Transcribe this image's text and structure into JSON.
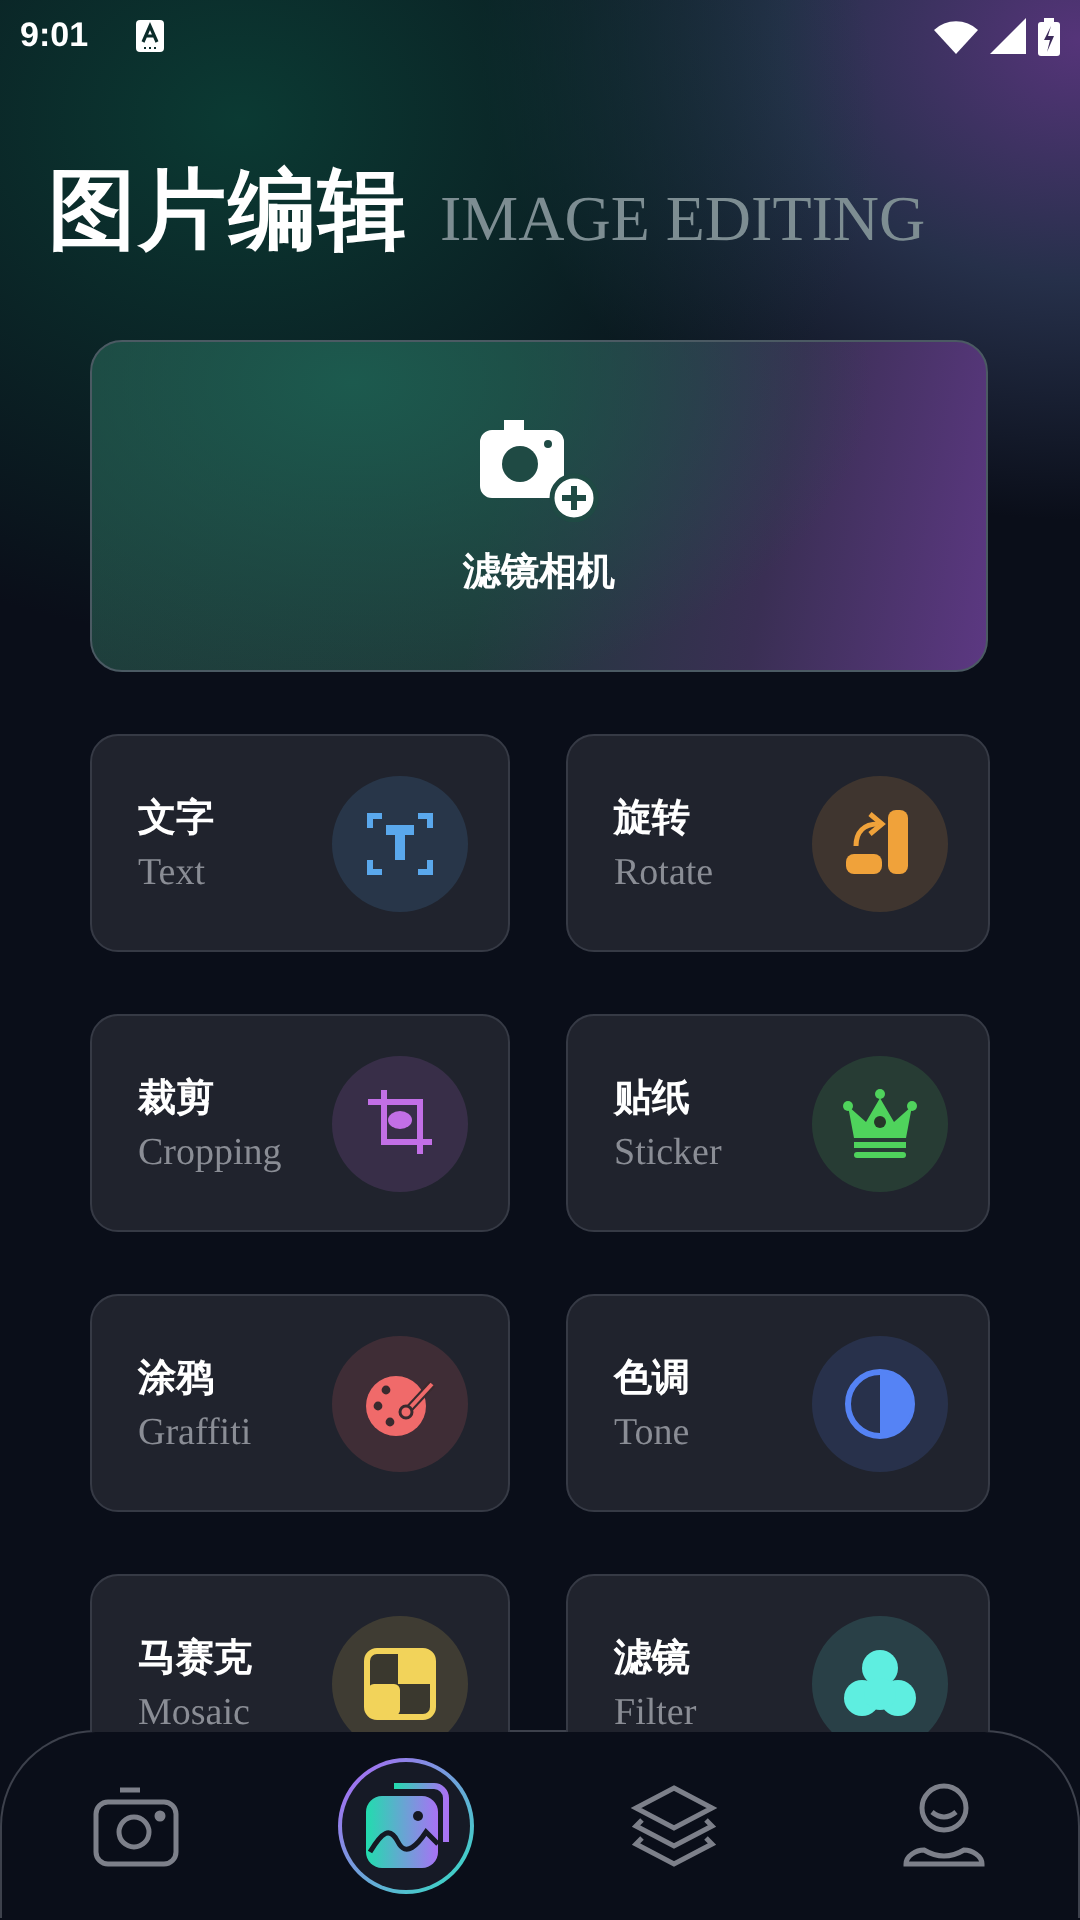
{
  "status_bar": {
    "time": "9:01"
  },
  "header": {
    "title": "图片编辑",
    "subtitle": "IMAGE EDITING"
  },
  "hero": {
    "label": "滤镜相机"
  },
  "tools": [
    {
      "kind": "text",
      "title": "文字",
      "subtitle": "Text",
      "color": "#5aa8ec"
    },
    {
      "kind": "rotate",
      "title": "旋转",
      "subtitle": "Rotate",
      "color": "#f0a23a"
    },
    {
      "kind": "crop",
      "title": "裁剪",
      "subtitle": "Cropping",
      "color": "#c26fe6"
    },
    {
      "kind": "sticker",
      "title": "贴纸",
      "subtitle": "Sticker",
      "color": "#4fd35c"
    },
    {
      "kind": "palette",
      "title": "涂鸦",
      "subtitle": "Graffiti",
      "color": "#f06a6a"
    },
    {
      "kind": "tone",
      "title": "色调",
      "subtitle": "Tone",
      "color": "#5583f5"
    },
    {
      "kind": "mosaic",
      "title": "马赛克",
      "subtitle": "Mosaic",
      "color": "#f2d35a"
    },
    {
      "kind": "filter",
      "title": "滤镜",
      "subtitle": "Filter",
      "color": "#5eeee0"
    }
  ],
  "nav": [
    {
      "kind": "camera",
      "selected": false
    },
    {
      "kind": "gallery",
      "selected": true
    },
    {
      "kind": "layers",
      "selected": false
    },
    {
      "kind": "profile",
      "selected": false
    }
  ]
}
